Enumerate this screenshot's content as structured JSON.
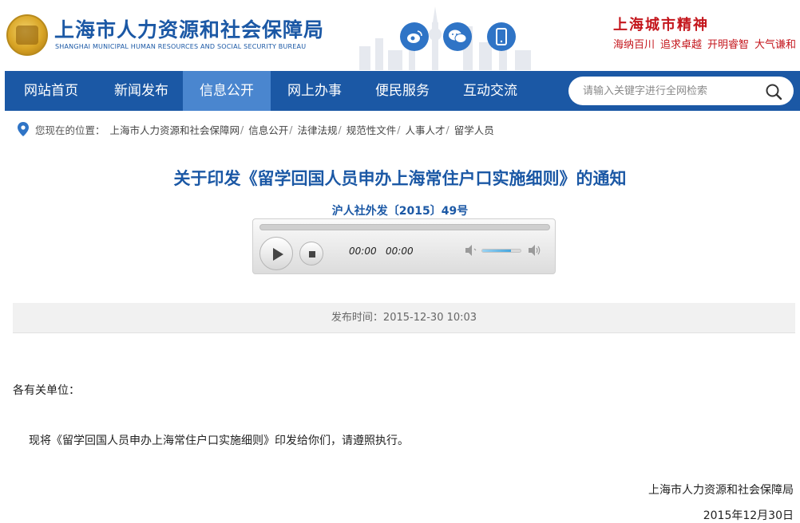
{
  "header": {
    "site_title": "上海市人力资源和社会保障局",
    "site_subtitle": "SHANGHAI MUNICIPAL HUMAN RESOURCES AND SOCIAL SECURITY BUREAU",
    "social_icons": [
      "weibo-icon",
      "wechat-icon",
      "mobile-icon"
    ],
    "spirit": {
      "title": "上海城市精神",
      "items": [
        "海纳百川",
        "追求卓越",
        "开明睿智",
        "大气谦和"
      ]
    }
  },
  "nav": {
    "items": [
      "网站首页",
      "新闻发布",
      "信息公开",
      "网上办事",
      "便民服务",
      "互动交流"
    ],
    "active_index": 2
  },
  "search": {
    "placeholder": "请输入关键字进行全网检索"
  },
  "breadcrumb": {
    "label": "您现在的位置：",
    "items": [
      "上海市人力资源和社会保障网",
      "信息公开",
      "法律法规",
      "规范性文件",
      "人事人才",
      "留学人员"
    ],
    "separator": "/"
  },
  "article": {
    "title": "关于印发《留学回国人员申办上海常住户口实施细则》的通知",
    "doc_number": "沪人社外发〔2015〕49号",
    "publish_time": "发布时间：2015-12-30 10:03",
    "salutation": "各有关单位：",
    "paragraph": "现将《留学回国人员申办上海常住户口实施细则》印发给你们，请遵照执行。",
    "signature_org": "上海市人力资源和社会保障局",
    "signature_date": "2015年12月30日"
  },
  "player": {
    "current_time": "00:00",
    "duration": "00:00",
    "volume_level": 0.75
  },
  "colors": {
    "brand_blue": "#1b58a5",
    "nav_active": "#4a86cf",
    "spirit_red": "#c4161c"
  }
}
